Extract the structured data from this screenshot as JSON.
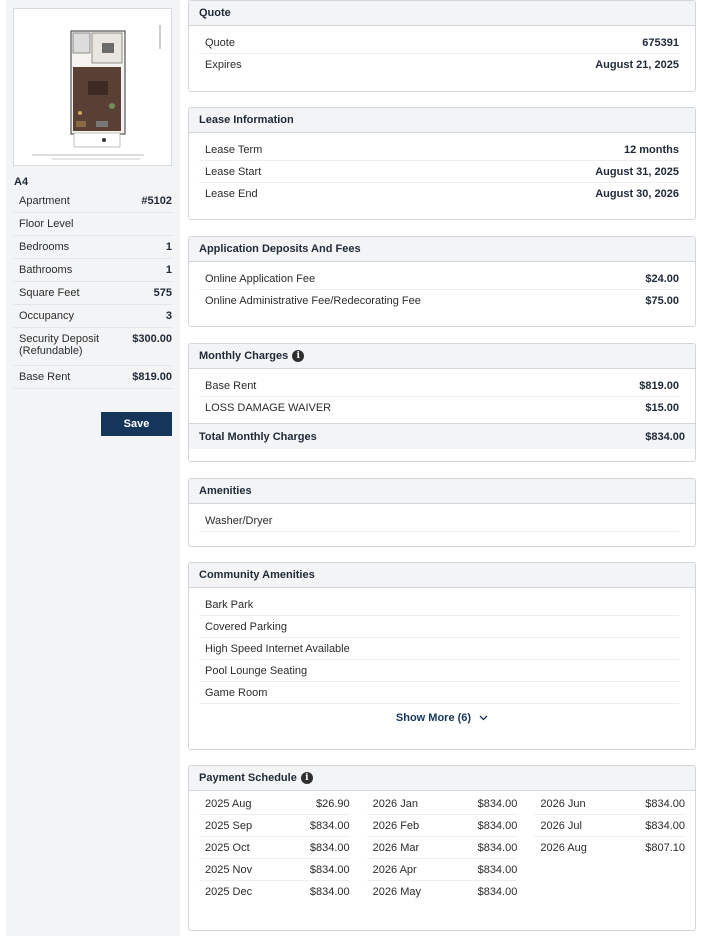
{
  "sidebar": {
    "unit_name": "A4",
    "specs": [
      {
        "label": "Apartment",
        "value": "#5102"
      },
      {
        "label": "Floor Level",
        "value": ""
      },
      {
        "label": "Bedrooms",
        "value": "1"
      },
      {
        "label": "Bathrooms",
        "value": "1"
      },
      {
        "label": "Square Feet",
        "value": "575"
      },
      {
        "label": "Occupancy",
        "value": "3"
      },
      {
        "label": "Security Deposit (Refundable)",
        "value": "$300.00"
      },
      {
        "label": "Base Rent",
        "value": "$819.00"
      }
    ],
    "save_label": "Save"
  },
  "quote": {
    "title": "Quote",
    "rows": [
      {
        "label": "Quote",
        "value": "675391"
      },
      {
        "label": "Expires",
        "value": "August 21, 2025"
      }
    ]
  },
  "lease": {
    "title": "Lease Information",
    "rows": [
      {
        "label": "Lease Term",
        "value": "12 months"
      },
      {
        "label": "Lease Start",
        "value": "August 31, 2025"
      },
      {
        "label": "Lease End",
        "value": "August 30, 2026"
      }
    ]
  },
  "deposits": {
    "title": "Application Deposits And Fees",
    "rows": [
      {
        "label": "Online Application Fee",
        "value": "$24.00"
      },
      {
        "label": "Online Administrative Fee/Redecorating Fee",
        "value": "$75.00"
      }
    ]
  },
  "monthly": {
    "title": "Monthly Charges",
    "rows": [
      {
        "label": "Base Rent",
        "value": "$819.00"
      },
      {
        "label": "LOSS DAMAGE WAIVER",
        "value": "$15.00"
      }
    ],
    "total_label": "Total Monthly Charges",
    "total_value": "$834.00"
  },
  "amenities": {
    "title": "Amenities",
    "items": [
      "Washer/Dryer"
    ]
  },
  "community": {
    "title": "Community Amenities",
    "items": [
      "Bark Park",
      "Covered Parking",
      "High Speed Internet Available",
      "Pool Lounge Seating",
      "Game Room"
    ],
    "show_more_label": "Show More (6)"
  },
  "schedule": {
    "title": "Payment Schedule",
    "columns": [
      [
        {
          "month": "2025 Aug",
          "amount": "$26.90"
        },
        {
          "month": "2025 Sep",
          "amount": "$834.00"
        },
        {
          "month": "2025 Oct",
          "amount": "$834.00"
        },
        {
          "month": "2025 Nov",
          "amount": "$834.00"
        },
        {
          "month": "2025 Dec",
          "amount": "$834.00"
        }
      ],
      [
        {
          "month": "2026 Jan",
          "amount": "$834.00"
        },
        {
          "month": "2026 Feb",
          "amount": "$834.00"
        },
        {
          "month": "2026 Mar",
          "amount": "$834.00"
        },
        {
          "month": "2026 Apr",
          "amount": "$834.00"
        },
        {
          "month": "2026 May",
          "amount": "$834.00"
        }
      ],
      [
        {
          "month": "2026 Jun",
          "amount": "$834.00"
        },
        {
          "month": "2026 Jul",
          "amount": "$834.00"
        },
        {
          "month": "2026 Aug",
          "amount": "$807.10"
        }
      ]
    ]
  },
  "icons": {
    "info": "info-icon",
    "chevron": "chevron-down-icon"
  },
  "colors": {
    "brand": "#14365a",
    "panel": "#f3f4f6",
    "border": "#d2d5da"
  }
}
